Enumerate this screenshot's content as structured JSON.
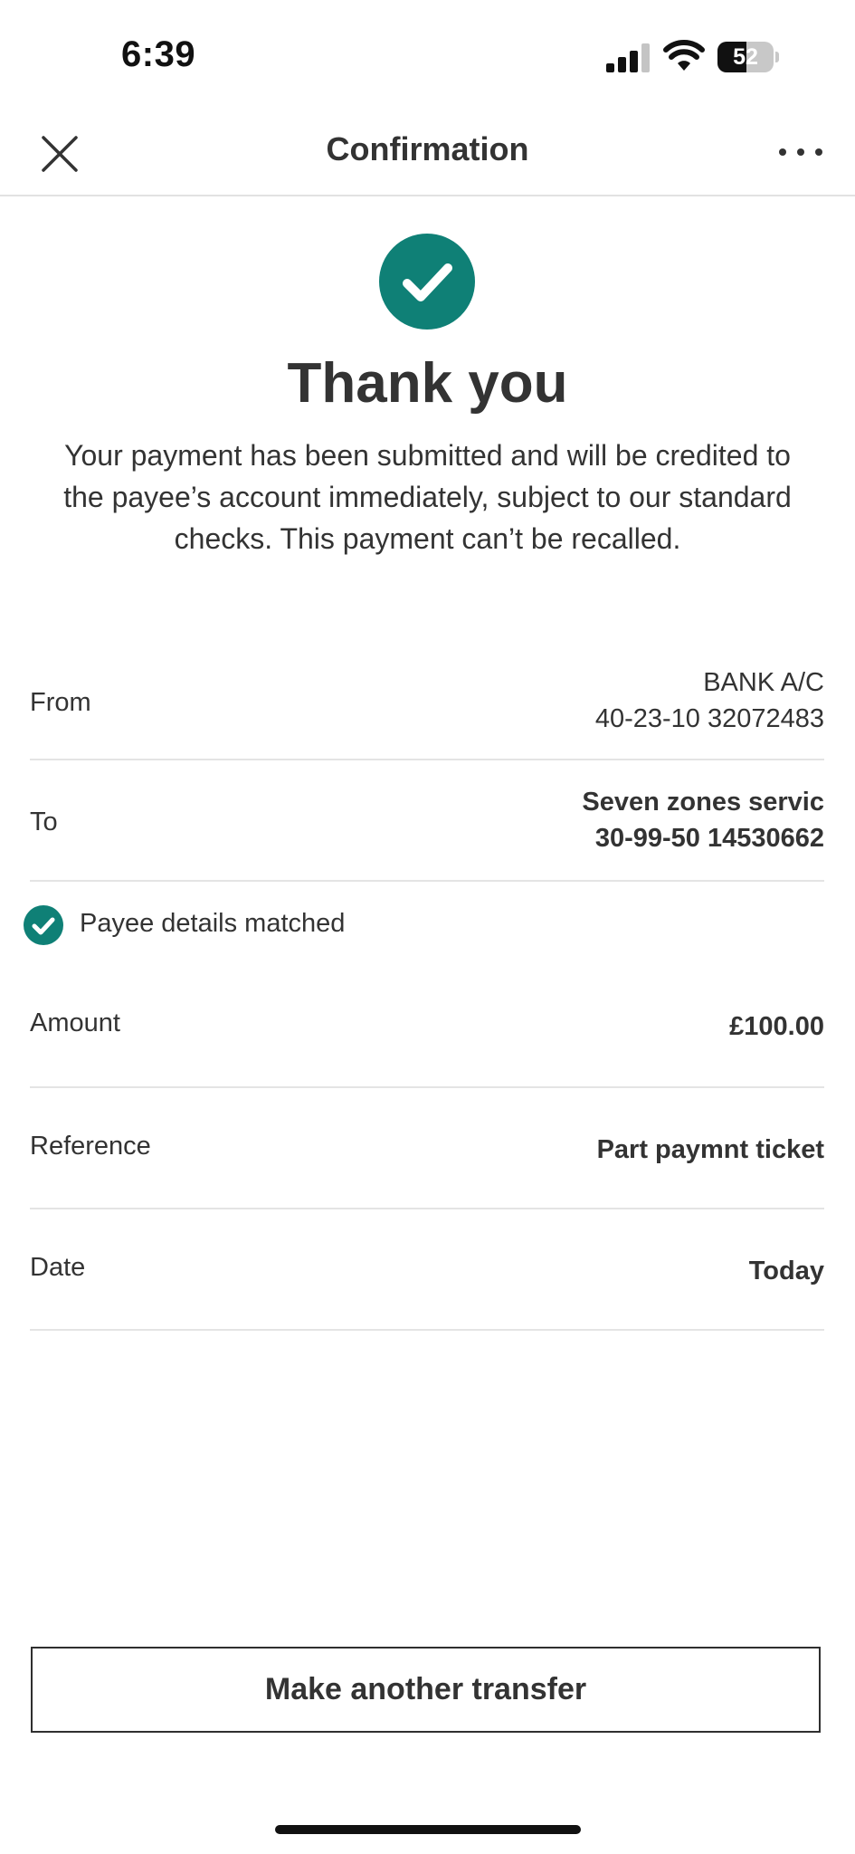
{
  "status_bar": {
    "time": "6:39",
    "battery_level": "52",
    "battery_fraction": 0.52
  },
  "header": {
    "title": "Confirmation",
    "close_icon": "close-icon",
    "more_icon": "more-horizontal-icon"
  },
  "success": {
    "icon": "check-circle-icon",
    "title": "Thank you",
    "message": "Your payment has been submitted and will be credited to the payee’s account immediately, subject to our standard checks. This payment can’t be recalled."
  },
  "details": {
    "from": {
      "label": "From",
      "line1": "BANK A/C",
      "line2": "40-23-10 32072483"
    },
    "to": {
      "label": "To",
      "line1": "Seven zones servic",
      "line2": "30-99-50 14530662"
    },
    "payee_match": {
      "icon": "check-circle-icon",
      "text": "Payee details matched"
    },
    "amount": {
      "label": "Amount",
      "value": "£100.00"
    },
    "reference": {
      "label": "Reference",
      "value": "Part paymnt ticket"
    },
    "date": {
      "label": "Date",
      "value": "Today"
    }
  },
  "actions": {
    "make_another_transfer": "Make another transfer"
  },
  "colors": {
    "accent": "#0f8076",
    "text": "#333333",
    "divider": "#e4e4e4"
  }
}
